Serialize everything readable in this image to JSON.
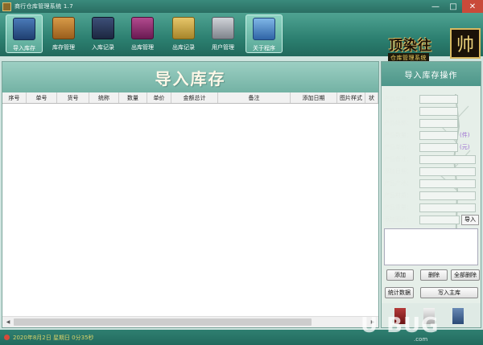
{
  "window": {
    "title": "商行仓库管理系统 1.7",
    "minimize_glyph": "—",
    "maximize_glyph": "□",
    "close_glyph": "✕"
  },
  "toolbar": {
    "items": [
      {
        "label": "导入库存",
        "icon": "briefcase-icon",
        "color": "#2b4f8e",
        "active": true
      },
      {
        "label": "库存管理",
        "icon": "wallet-icon",
        "color": "#b8782a"
      },
      {
        "label": "入库记录",
        "icon": "notebook-icon",
        "color": "#2a3a5e"
      },
      {
        "label": "出库管理",
        "icon": "cash-register-icon",
        "color": "#8a2a6a"
      },
      {
        "label": "出库记录",
        "icon": "folder-icon",
        "color": "#c9a645"
      },
      {
        "label": "用户管理",
        "icon": "computer-icon",
        "color": "#8b8f96"
      },
      {
        "label": "关于程序",
        "icon": "tools-icon",
        "color": "#3a6fb0"
      }
    ]
  },
  "logo": {
    "title": "顶染往",
    "subtitle": "仓库管理系统",
    "seal": "帅"
  },
  "main": {
    "heading": "导入库存",
    "columns": [
      "序号",
      "单号",
      "货号",
      "统称",
      "数量",
      "单价",
      "金额总计",
      "备注",
      "添加日期",
      "图片样式",
      "状"
    ],
    "rows": []
  },
  "side": {
    "heading": "导入库存操作",
    "fields": [
      {
        "label": "产品单号："
      },
      {
        "label": "产品货号："
      },
      {
        "label": "产品统称："
      },
      {
        "label": "产品数量：",
        "unit": "(件)"
      },
      {
        "label": "产品单价：",
        "unit": "(元)"
      },
      {
        "label": "产品备注："
      },
      {
        "label": "添加日期："
      },
      {
        "label": "产品产地："
      },
      {
        "label": "产品材质："
      },
      {
        "label": "产品重量："
      },
      {
        "label": "添加图片："
      }
    ],
    "import_label": "导入",
    "buttons": {
      "add": "添加",
      "delete": "删除",
      "delete_all": "全部删除",
      "stats": "统计数据",
      "write_main": "写入主库"
    }
  },
  "status": {
    "text": "2020年8月2日 星期日 0分35秒"
  },
  "watermark": {
    "text": "U BUG",
    "sub": ".com"
  }
}
